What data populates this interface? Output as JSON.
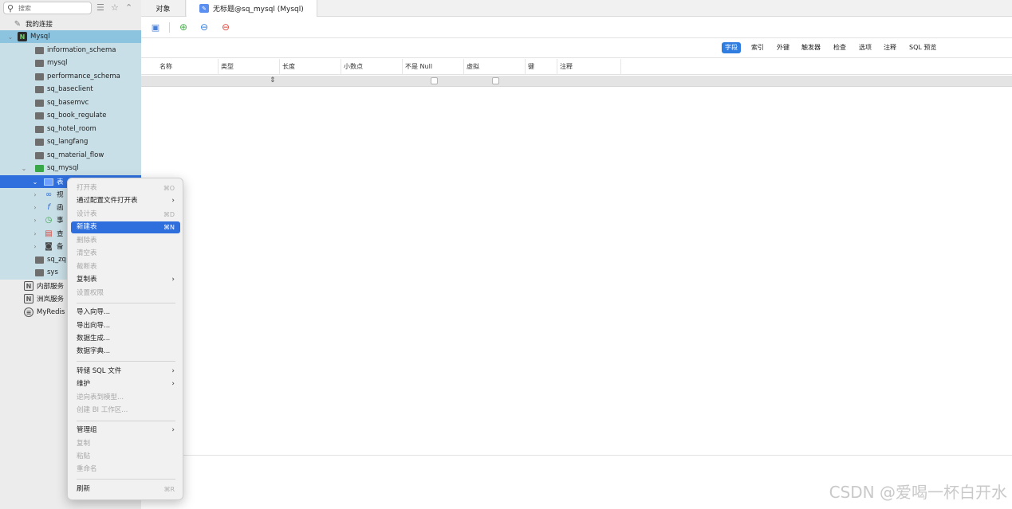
{
  "sidebar": {
    "search_placeholder": "搜索",
    "items": [
      {
        "label": "我的连接",
        "icon": "connection-group-icon"
      },
      {
        "label": "Mysql",
        "icon": "mysql-connection-icon"
      },
      {
        "label": "information_schema",
        "icon": "database-icon"
      },
      {
        "label": "mysql",
        "icon": "database-icon"
      },
      {
        "label": "performance_schema",
        "icon": "database-icon"
      },
      {
        "label": "sq_baseclient",
        "icon": "database-icon"
      },
      {
        "label": "sq_basemvc",
        "icon": "database-icon"
      },
      {
        "label": "sq_book_regulate",
        "icon": "database-icon"
      },
      {
        "label": "sq_hotel_room",
        "icon": "database-icon"
      },
      {
        "label": "sq_langfang",
        "icon": "database-icon"
      },
      {
        "label": "sq_material_flow",
        "icon": "database-icon"
      },
      {
        "label": "sq_mysql",
        "icon": "database-open-icon"
      },
      {
        "label": "表",
        "icon": "table-icon"
      },
      {
        "label": "视",
        "icon": "view-icon"
      },
      {
        "label": "函",
        "icon": "function-icon"
      },
      {
        "label": "事",
        "icon": "event-icon"
      },
      {
        "label": "查",
        "icon": "query-icon"
      },
      {
        "label": "备",
        "icon": "backup-icon"
      },
      {
        "label": "sq_zq",
        "icon": "database-icon"
      },
      {
        "label": "sys",
        "icon": "database-icon"
      },
      {
        "label": "内部服务",
        "icon": "connection-icon"
      },
      {
        "label": "洲岚服务",
        "icon": "connection-icon"
      },
      {
        "label": "MyRedis",
        "icon": "redis-icon"
      }
    ]
  },
  "tabs": {
    "objects": "对象",
    "active": "无标题@sq_mysql (Mysql)"
  },
  "subtabs": [
    "字段",
    "索引",
    "外键",
    "触发器",
    "检查",
    "选项",
    "注释",
    "SQL 预览"
  ],
  "columns": [
    "名称",
    "类型",
    "长度",
    "小数点",
    "不是 Null",
    "虚拟",
    "键",
    "注释"
  ],
  "context_menu": [
    {
      "label": "打开表",
      "shortcut": "⌘O",
      "disabled": true
    },
    {
      "label": "通过配置文件打开表",
      "submenu": true
    },
    {
      "label": "设计表",
      "shortcut": "⌘D",
      "disabled": true
    },
    {
      "label": "新建表",
      "shortcut": "⌘N",
      "highlighted": true
    },
    {
      "label": "删除表",
      "disabled": true
    },
    {
      "label": "清空表",
      "disabled": true
    },
    {
      "label": "截断表",
      "disabled": true
    },
    {
      "label": "复制表",
      "submenu": true
    },
    {
      "label": "设置权限",
      "disabled": true
    },
    {
      "label": "导入向导..."
    },
    {
      "label": "导出向导..."
    },
    {
      "label": "数据生成..."
    },
    {
      "label": "数据字典..."
    },
    {
      "label": "转储 SQL 文件",
      "submenu": true
    },
    {
      "label": "维护",
      "submenu": true
    },
    {
      "label": "逆向表到模型...",
      "disabled": true
    },
    {
      "label": "创建 BI 工作区...",
      "disabled": true
    },
    {
      "label": "管理组",
      "submenu": true
    },
    {
      "label": "复制",
      "disabled": true
    },
    {
      "label": "粘贴",
      "disabled": true
    },
    {
      "label": "重命名",
      "disabled": true
    },
    {
      "label": "刷新",
      "shortcut": "⌘R"
    }
  ],
  "watermark": "CSDN @爱喝一杯白开水",
  "colors": {
    "accent": "#2f6fdd",
    "selection_band": "#c9dfe7",
    "tab_accent": "#2f7de0"
  }
}
